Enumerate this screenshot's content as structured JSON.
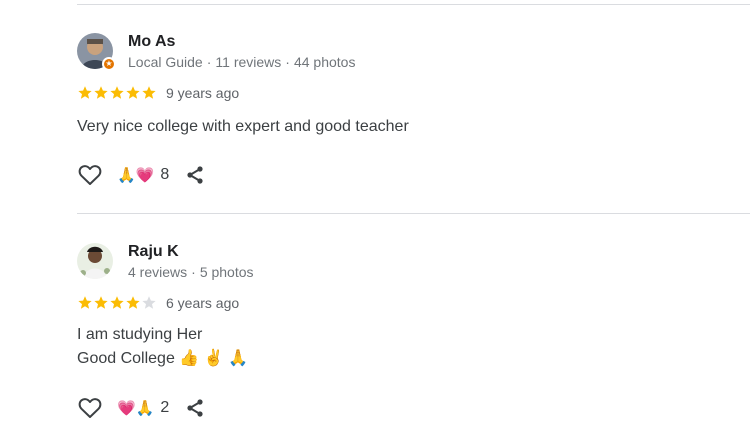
{
  "colors": {
    "star_filled": "#fbbc04",
    "star_empty": "#dadce0",
    "divider": "#dadce0",
    "local_guide_badge": "#e37400"
  },
  "reviews": [
    {
      "name": "Mo As",
      "meta": [
        "Local Guide",
        "11 reviews",
        "44 photos"
      ],
      "rating": 5,
      "date": "9 years ago",
      "text": "Very nice college with expert and good teacher",
      "reactions": "🙏💗",
      "reaction_count": "8"
    },
    {
      "name": "Raju K",
      "meta": [
        "4 reviews",
        "5 photos"
      ],
      "rating": 4,
      "date": "6 years ago",
      "text": "I am studying Her\nGood College 👍 ✌️ 🙏",
      "reactions": "💗🙏",
      "reaction_count": "2"
    }
  ]
}
